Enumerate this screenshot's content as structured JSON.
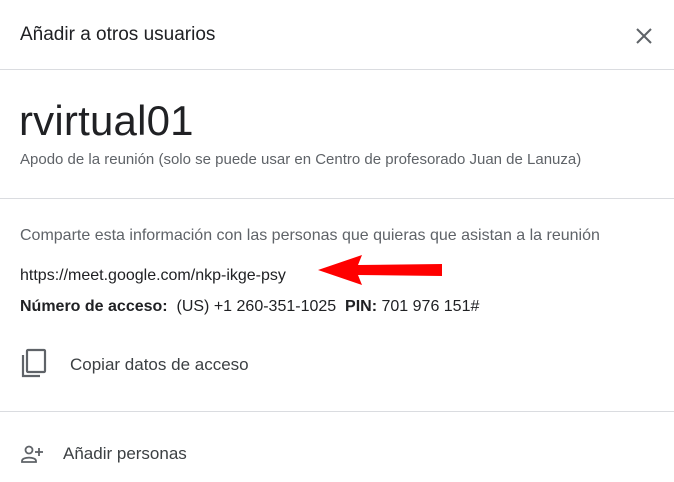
{
  "dialog": {
    "title": "Añadir a otros usuarios",
    "close_icon": "close-icon"
  },
  "meeting": {
    "code": "rvirtual01",
    "nickname_note": "Apodo de la reunión (solo se puede usar en Centro de profesorado Juan de Lanuza)"
  },
  "share": {
    "hint": "Comparte esta información con las personas que quieras que asistan a la reunión",
    "link": "https://meet.google.com/nkp-ikge-psy",
    "access_label": "Número de acceso:",
    "access_number": "(US) +1 260-351-1025",
    "pin_label": "PIN:",
    "pin_value": "701 976 151#",
    "copy_label": "Copiar datos de acceso",
    "copy_icon": "copy-icon"
  },
  "actions": {
    "add_people_label": "Añadir personas",
    "add_people_icon": "person-add-icon"
  },
  "annotation": {
    "arrow_icon": "red-arrow-icon",
    "arrow_color": "#ff0000"
  },
  "colors": {
    "text_primary": "#202124",
    "text_secondary": "#5f6368",
    "divider": "#dadce0"
  }
}
